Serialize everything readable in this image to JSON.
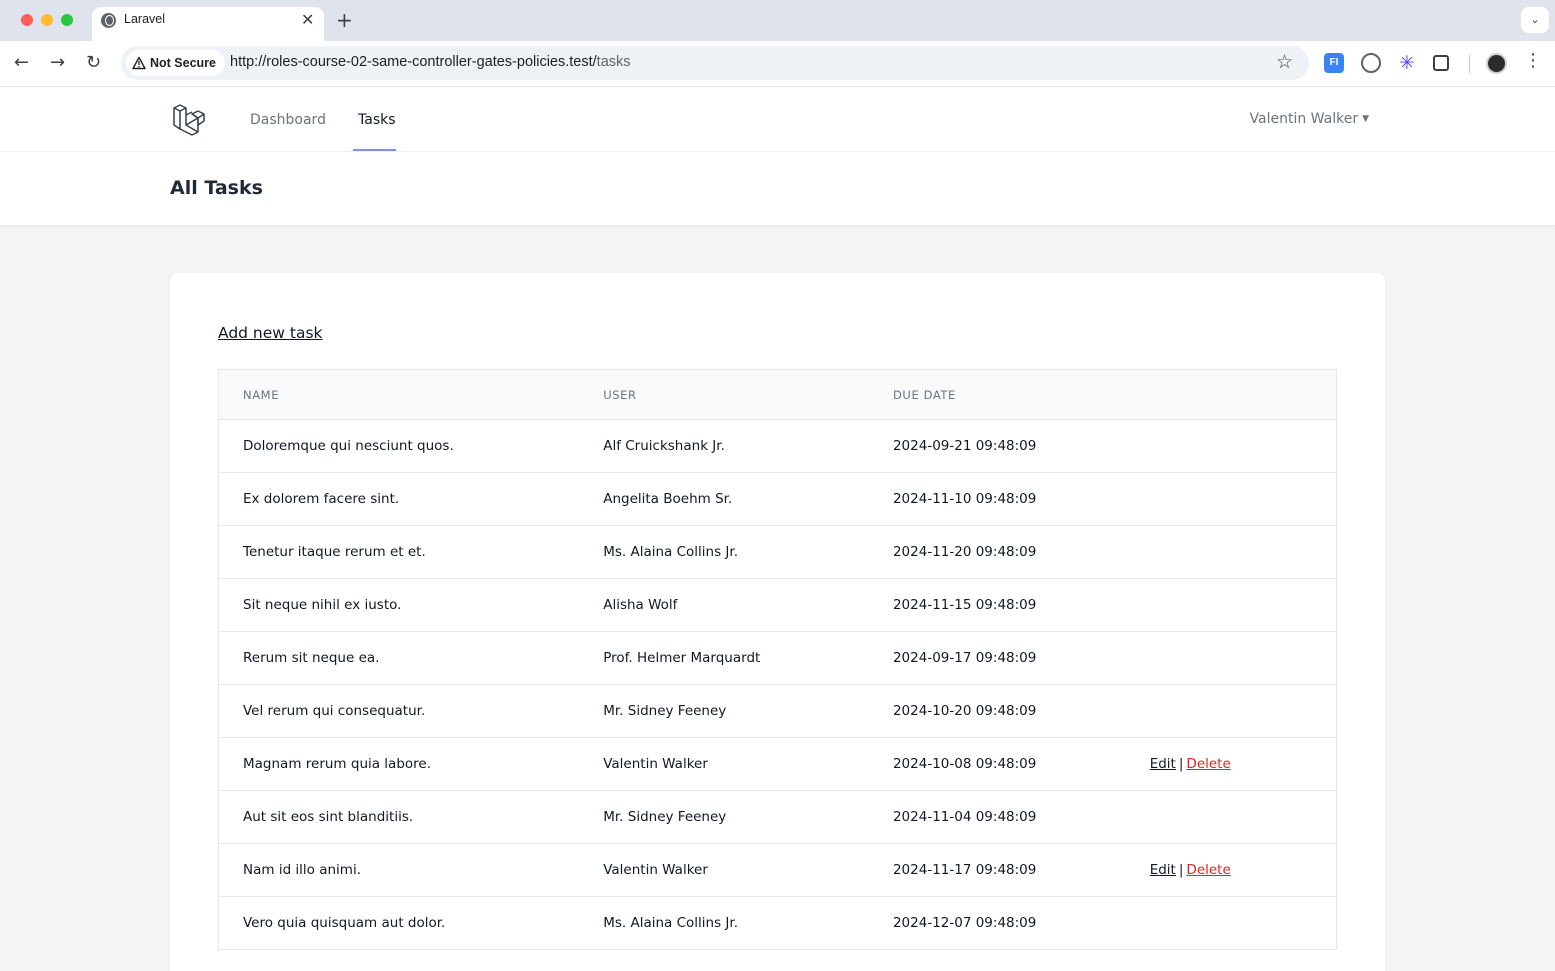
{
  "browser": {
    "tab_title": "Laravel",
    "tab_close": "✕",
    "new_tab": "+",
    "tab_menu": "⌄",
    "security_label": "Not Secure",
    "url_host": "http://roles-course-02-same-controller-gates-policies.test/",
    "url_path": "tasks",
    "ext1_label": "FI"
  },
  "nav": {
    "links": [
      {
        "label": "Dashboard",
        "active": false
      },
      {
        "label": "Tasks",
        "active": true
      }
    ],
    "user_name": "Valentin Walker"
  },
  "header": {
    "title": "All Tasks"
  },
  "tasks": {
    "add_label": "Add new task",
    "columns": [
      "NAME",
      "USER",
      "DUE DATE"
    ],
    "action_labels": {
      "edit": "Edit",
      "separator": "|",
      "delete": "Delete"
    },
    "rows": [
      {
        "name": "Doloremque qui nesciunt quos.",
        "user": "Alf Cruickshank Jr.",
        "due": "2024-09-21 09:48:09",
        "can_edit": false
      },
      {
        "name": "Ex dolorem facere sint.",
        "user": "Angelita Boehm Sr.",
        "due": "2024-11-10 09:48:09",
        "can_edit": false
      },
      {
        "name": "Tenetur itaque rerum et et.",
        "user": "Ms. Alaina Collins Jr.",
        "due": "2024-11-20 09:48:09",
        "can_edit": false
      },
      {
        "name": "Sit neque nihil ex iusto.",
        "user": "Alisha Wolf",
        "due": "2024-11-15 09:48:09",
        "can_edit": false
      },
      {
        "name": "Rerum sit neque ea.",
        "user": "Prof. Helmer Marquardt",
        "due": "2024-09-17 09:48:09",
        "can_edit": false
      },
      {
        "name": "Vel rerum qui consequatur.",
        "user": "Mr. Sidney Feeney",
        "due": "2024-10-20 09:48:09",
        "can_edit": false
      },
      {
        "name": "Magnam rerum quia labore.",
        "user": "Valentin Walker",
        "due": "2024-10-08 09:48:09",
        "can_edit": true
      },
      {
        "name": "Aut sit eos sint blanditiis.",
        "user": "Mr. Sidney Feeney",
        "due": "2024-11-04 09:48:09",
        "can_edit": false
      },
      {
        "name": "Nam id illo animi.",
        "user": "Valentin Walker",
        "due": "2024-11-17 09:48:09",
        "can_edit": true
      },
      {
        "name": "Vero quia quisquam aut dolor.",
        "user": "Ms. Alaina Collins Jr.",
        "due": "2024-12-07 09:48:09",
        "can_edit": false
      }
    ]
  }
}
